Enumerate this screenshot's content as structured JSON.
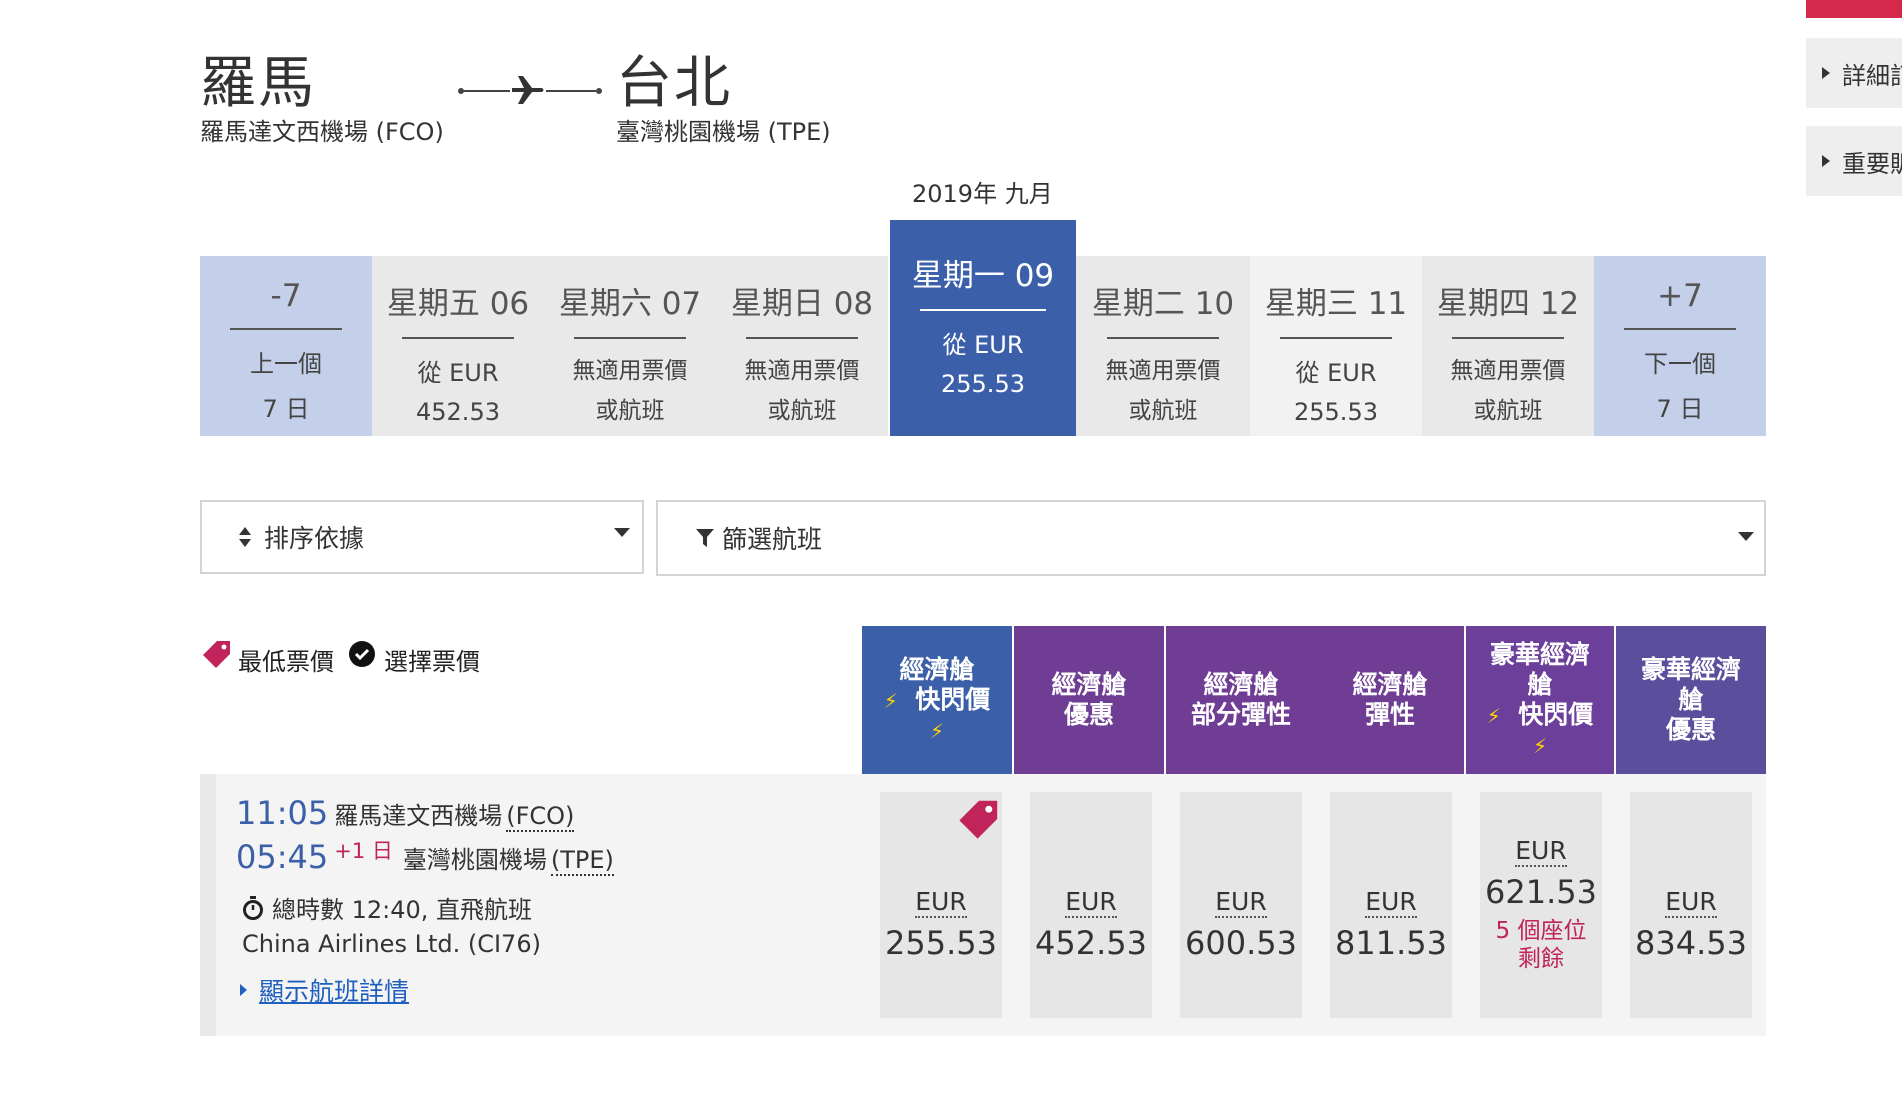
{
  "route": {
    "origin_city": "羅馬",
    "origin_airport": "羅馬達文西機場 (FCO)",
    "dest_city": "台北",
    "dest_airport": "臺灣桃園機場 (TPE)"
  },
  "month_label": "2019年 九月",
  "dates": [
    {
      "day": "-7",
      "line1": "上一個",
      "line2": "7 日",
      "kind": "nav"
    },
    {
      "day": "星期五 06",
      "line1": "從 EUR",
      "line2": "452.53",
      "kind": "price"
    },
    {
      "day": "星期六 07",
      "line1": "無適用票價",
      "line2": "或航班",
      "kind": "none"
    },
    {
      "day": "星期日 08",
      "line1": "無適用票價",
      "line2": "或航班",
      "kind": "none"
    },
    {
      "day": "星期一 09",
      "line1": "從 EUR",
      "line2": "255.53",
      "kind": "selected"
    },
    {
      "day": "星期二 10",
      "line1": "無適用票價",
      "line2": "或航班",
      "kind": "none"
    },
    {
      "day": "星期三 11",
      "line1": "從 EUR",
      "line2": "255.53",
      "kind": "price"
    },
    {
      "day": "星期四 12",
      "line1": "無適用票價",
      "line2": "或航班",
      "kind": "none"
    },
    {
      "day": "+7",
      "line1": "下一個",
      "line2": "7 日",
      "kind": "nav"
    }
  ],
  "controls": {
    "sort_label": "排序依據",
    "filter_label": "篩選航班"
  },
  "legend": {
    "lowest": "最低票價",
    "selected": "選擇票價"
  },
  "fare_headers": [
    {
      "l1": "經濟艙",
      "l2": "快閃價",
      "flash": true,
      "color": "#3b5fa8"
    },
    {
      "l1": "經濟艙",
      "l2": "優惠",
      "flash": false,
      "color": "#6f3d94"
    },
    {
      "l1": "經濟艙",
      "l2": "部分彈性",
      "flash": false,
      "color": "#6f3d94"
    },
    {
      "l1": "經濟艙",
      "l2": "彈性",
      "flash": false,
      "color": "#6f3d94"
    },
    {
      "l1": "豪華經濟艙",
      "l2": "快閃價",
      "flash": true,
      "color": "#6b3f9a"
    },
    {
      "l1": "豪華經濟艙",
      "l2": "優惠",
      "flash": false,
      "color": "#5b4e9c"
    }
  ],
  "flight": {
    "dep_time": "11:05",
    "dep_airport_name": "羅馬達文西機場",
    "dep_code": "(FCO)",
    "arr_time": "05:45",
    "arr_offset": "+1 日",
    "arr_airport_name": "臺灣桃園機場",
    "arr_code": "(TPE)",
    "duration": "總時數 12:40, 直飛航班",
    "airline": "China Airlines Ltd. (CI76)",
    "details_link": "顯示航班詳情"
  },
  "fares": [
    {
      "currency": "EUR",
      "amount": "255.53",
      "lowest": true,
      "seats": ""
    },
    {
      "currency": "EUR",
      "amount": "452.53",
      "lowest": false,
      "seats": ""
    },
    {
      "currency": "EUR",
      "amount": "600.53",
      "lowest": false,
      "seats": ""
    },
    {
      "currency": "EUR",
      "amount": "811.53",
      "lowest": false,
      "seats": ""
    },
    {
      "currency": "EUR",
      "amount": "621.53",
      "lowest": false,
      "seats": "5 個座位剩餘"
    },
    {
      "currency": "EUR",
      "amount": "834.53",
      "lowest": false,
      "seats": ""
    }
  ],
  "side": {
    "item1": "詳細訂",
    "item2": "重要販"
  },
  "colors": {
    "brand_blue": "#3b5fa8",
    "nav_blue": "#c4d0ea",
    "purple": "#6f3d94",
    "accent_red": "#c0245a",
    "top_bar_red": "#d4294b"
  }
}
